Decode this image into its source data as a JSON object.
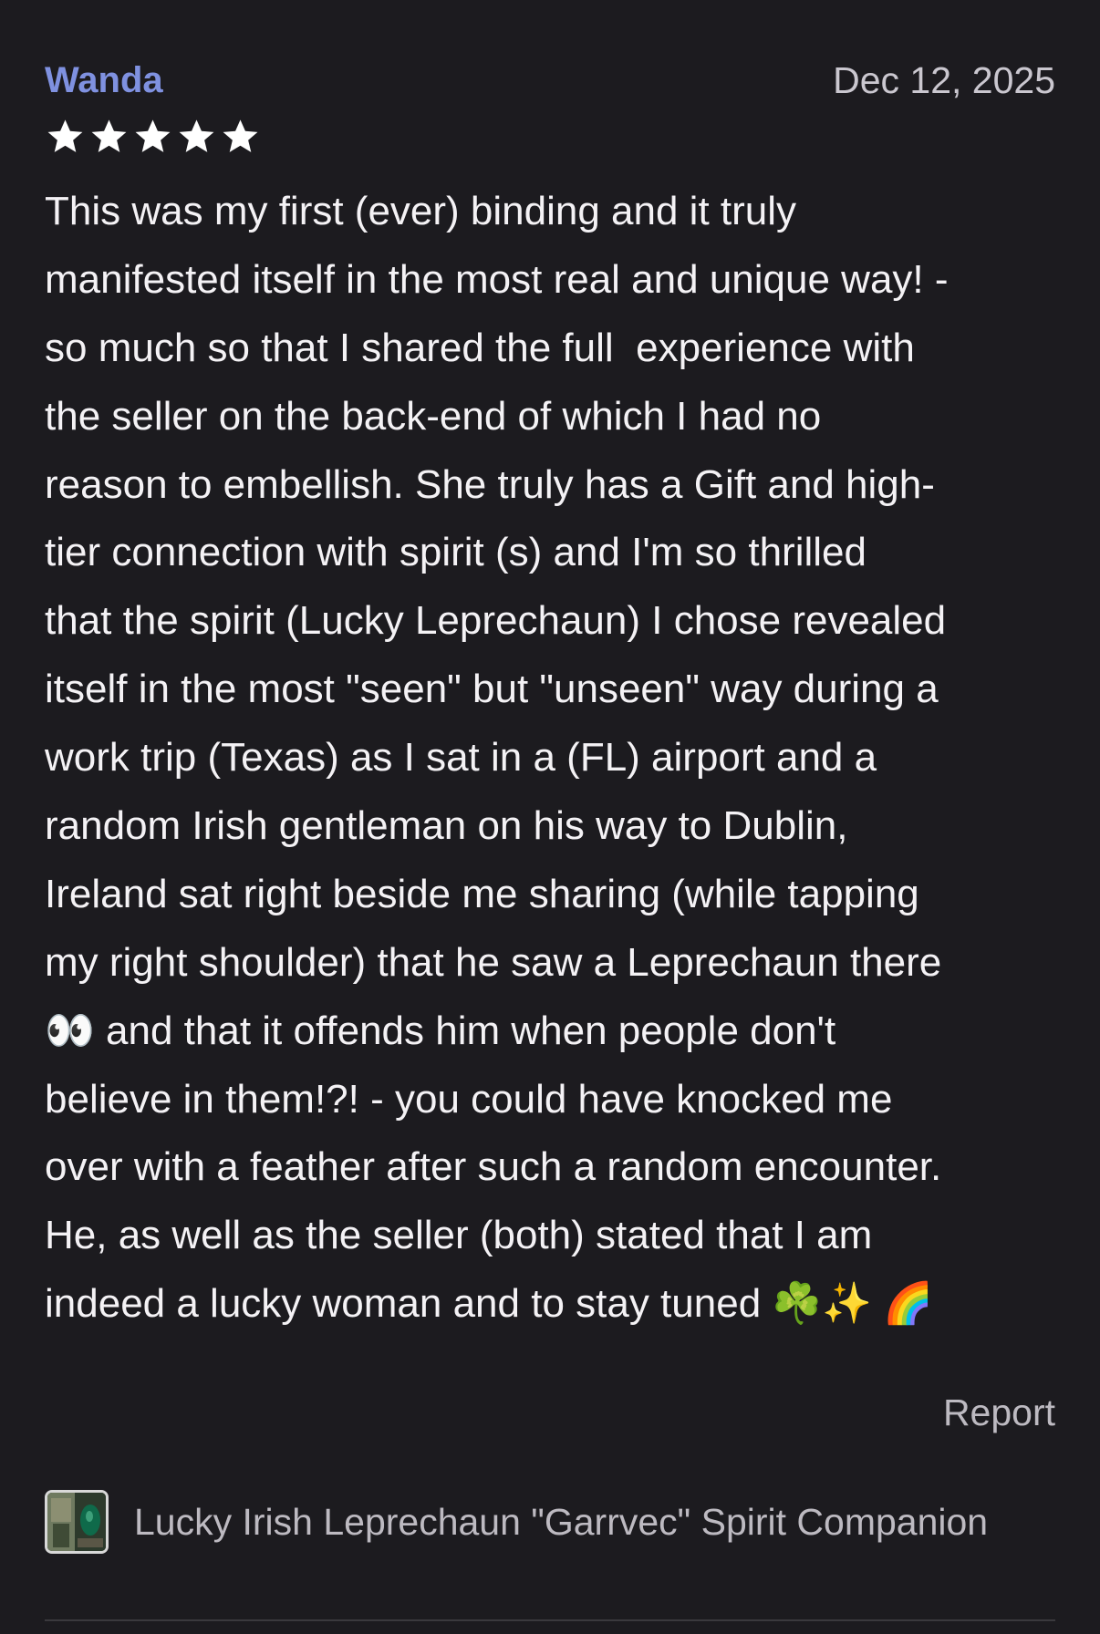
{
  "review": {
    "reviewer_name": "Wanda",
    "date": "Dec 12, 2025",
    "rating": 5,
    "rating_max": 5,
    "text_lines": [
      "This was my first (ever) binding and it truly",
      "manifested itself in the most real and unique way! -",
      "so much so that I shared the full  experience with",
      "the seller on the back-end of which I had no",
      "reason to embellish. She truly has a Gift and high-",
      "tier connection with spirit (s) and I'm so thrilled",
      "that the spirit (Lucky Leprechaun) I chose revealed",
      "itself in the most \"seen\" but \"unseen\" way during a",
      "work trip (Texas) as I sat in a (FL) airport and a",
      "random Irish gentleman on his way to Dublin,",
      "Ireland sat right beside me sharing (while tapping",
      "my right shoulder) that he saw a Leprechaun there",
      "👀 and that it offends him when people don't",
      "believe in them!?! - you could have knocked me",
      "over with a feather after such a random encounter.",
      "He, as well as the seller (both) stated that I am",
      "indeed a lucky woman and to stay tuned ☘️✨ 🌈"
    ],
    "report_label": "Report"
  },
  "listing": {
    "title": "Lucky Irish Leprechaun \"Garrvec\" Spirit Companion",
    "thumbnail_icon": "listing-thumbnail"
  },
  "colors": {
    "background": "#1c1b1f",
    "reviewer_name": "#7f91e0",
    "body_text": "#f4f2f5",
    "muted_text": "#bdbac1",
    "star": "#ffffff"
  }
}
